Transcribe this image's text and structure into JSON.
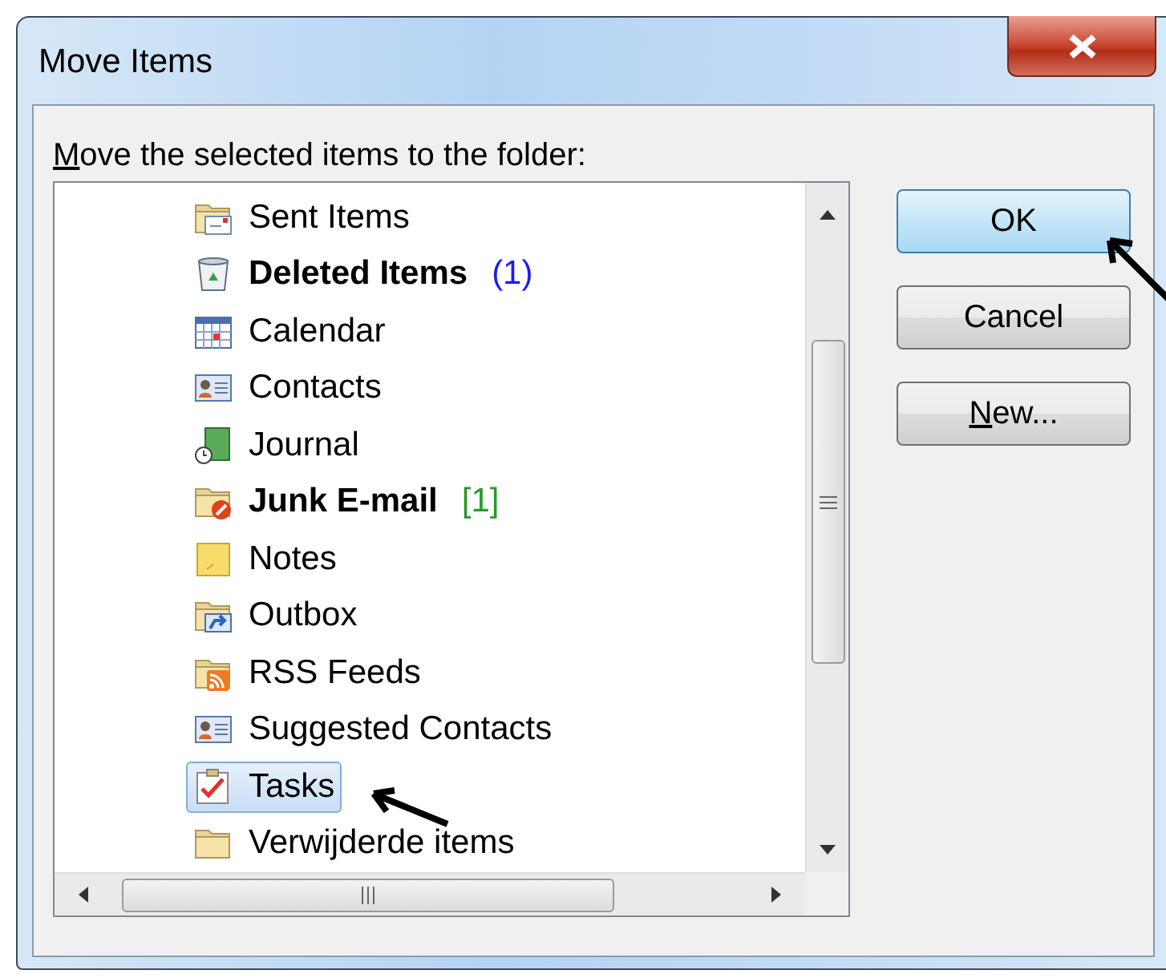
{
  "window": {
    "title": "Move Items"
  },
  "prompt": {
    "text": "Move the selected items to the folder:"
  },
  "folders": [
    {
      "label": "Sent Items",
      "kind": "sent",
      "bold": false,
      "selected": false
    },
    {
      "label": "Deleted Items",
      "kind": "trash",
      "bold": true,
      "selected": false,
      "count": {
        "text": "(1)",
        "color": "#1a1aff"
      }
    },
    {
      "label": "Calendar",
      "kind": "calendar",
      "bold": false,
      "selected": false
    },
    {
      "label": "Contacts",
      "kind": "contacts",
      "bold": false,
      "selected": false
    },
    {
      "label": "Journal",
      "kind": "journal",
      "bold": false,
      "selected": false
    },
    {
      "label": "Junk E-mail",
      "kind": "junk",
      "bold": true,
      "selected": false,
      "count": {
        "text": "[1]",
        "color": "#2a9a2a"
      }
    },
    {
      "label": "Notes",
      "kind": "notes",
      "bold": false,
      "selected": false
    },
    {
      "label": "Outbox",
      "kind": "outbox",
      "bold": false,
      "selected": false
    },
    {
      "label": "RSS Feeds",
      "kind": "rss",
      "bold": false,
      "selected": false
    },
    {
      "label": "Suggested Contacts",
      "kind": "contacts",
      "bold": false,
      "selected": false
    },
    {
      "label": "Tasks",
      "kind": "tasks",
      "bold": false,
      "selected": true
    },
    {
      "label": "Verwijderde items",
      "kind": "folder",
      "bold": false,
      "selected": false
    }
  ],
  "buttons": [
    {
      "label": "OK",
      "default": true
    },
    {
      "label": "Cancel",
      "default": false
    },
    {
      "label": "New...",
      "default": false
    }
  ]
}
